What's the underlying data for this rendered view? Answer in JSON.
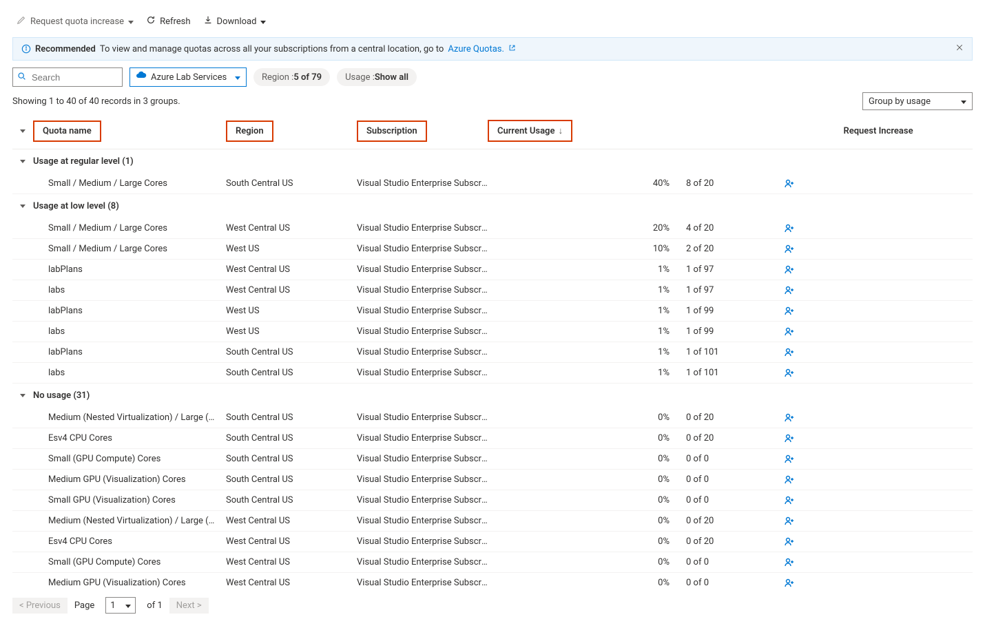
{
  "toolbar": {
    "request_label": "Request quota increase",
    "refresh_label": "Refresh",
    "download_label": "Download"
  },
  "info": {
    "recommended": "Recommended",
    "text": "To view and manage quotas across all your subscriptions from a central location, go to ",
    "link": "Azure Quotas."
  },
  "filters": {
    "search_placeholder": "Search",
    "provider": "Azure Lab Services",
    "region_label": "Region : ",
    "region_value": "5 of 79",
    "usage_label": "Usage : ",
    "usage_value": "Show all"
  },
  "summary": "Showing 1 to 40 of 40 records in 3 groups.",
  "group_select": "Group by usage",
  "headers": {
    "quota": "Quota name",
    "region": "Region",
    "subscription": "Subscription",
    "usage": "Current Usage",
    "request": "Request Increase"
  },
  "groups": [
    {
      "title": "Usage at regular level (1)",
      "rows": [
        {
          "quota": "Small / Medium / Large Cores",
          "region": "South Central US",
          "sub": "Visual Studio Enterprise Subscri…",
          "pct": 40,
          "color": "green",
          "of": "8 of 20"
        }
      ]
    },
    {
      "title": "Usage at low level (8)",
      "rows": [
        {
          "quota": "Small / Medium / Large Cores",
          "region": "West Central US",
          "sub": "Visual Studio Enterprise Subscri…",
          "pct": 20,
          "color": "blue",
          "of": "4 of 20"
        },
        {
          "quota": "Small / Medium / Large Cores",
          "region": "West US",
          "sub": "Visual Studio Enterprise Subscri…",
          "pct": 10,
          "color": "blue",
          "of": "2 of 20"
        },
        {
          "quota": "labPlans",
          "region": "West Central US",
          "sub": "Visual Studio Enterprise Subscri…",
          "pct": 1,
          "color": "blue",
          "of": "1 of 97"
        },
        {
          "quota": "labs",
          "region": "West Central US",
          "sub": "Visual Studio Enterprise Subscri…",
          "pct": 1,
          "color": "blue",
          "of": "1 of 97"
        },
        {
          "quota": "labPlans",
          "region": "West US",
          "sub": "Visual Studio Enterprise Subscri…",
          "pct": 1,
          "color": "blue",
          "of": "1 of 99"
        },
        {
          "quota": "labs",
          "region": "West US",
          "sub": "Visual Studio Enterprise Subscri…",
          "pct": 1,
          "color": "blue",
          "of": "1 of 99"
        },
        {
          "quota": "labPlans",
          "region": "South Central US",
          "sub": "Visual Studio Enterprise Subscri…",
          "pct": 1,
          "color": "blue",
          "of": "1 of 101"
        },
        {
          "quota": "labs",
          "region": "South Central US",
          "sub": "Visual Studio Enterprise Subscri…",
          "pct": 1,
          "color": "blue",
          "of": "1 of 101"
        }
      ]
    },
    {
      "title": "No usage (31)",
      "rows": [
        {
          "quota": "Medium (Nested Virtualization) / Large (Nested …",
          "region": "South Central US",
          "sub": "Visual Studio Enterprise Subscri…",
          "pct": 0,
          "color": "blue",
          "of": "0 of 20"
        },
        {
          "quota": "Esv4 CPU Cores",
          "region": "South Central US",
          "sub": "Visual Studio Enterprise Subscri…",
          "pct": 0,
          "color": "blue",
          "of": "0 of 20"
        },
        {
          "quota": "Small (GPU Compute) Cores",
          "region": "South Central US",
          "sub": "Visual Studio Enterprise Subscri…",
          "pct": 0,
          "color": "blue",
          "of": "0 of 0"
        },
        {
          "quota": "Medium GPU (Visualization) Cores",
          "region": "South Central US",
          "sub": "Visual Studio Enterprise Subscri…",
          "pct": 0,
          "color": "blue",
          "of": "0 of 0"
        },
        {
          "quota": "Small GPU (Visualization) Cores",
          "region": "South Central US",
          "sub": "Visual Studio Enterprise Subscri…",
          "pct": 0,
          "color": "blue",
          "of": "0 of 0"
        },
        {
          "quota": "Medium (Nested Virtualization) / Large (Nested …",
          "region": "West Central US",
          "sub": "Visual Studio Enterprise Subscri…",
          "pct": 0,
          "color": "blue",
          "of": "0 of 20"
        },
        {
          "quota": "Esv4 CPU Cores",
          "region": "West Central US",
          "sub": "Visual Studio Enterprise Subscri…",
          "pct": 0,
          "color": "blue",
          "of": "0 of 20"
        },
        {
          "quota": "Small (GPU Compute) Cores",
          "region": "West Central US",
          "sub": "Visual Studio Enterprise Subscri…",
          "pct": 0,
          "color": "blue",
          "of": "0 of 0"
        },
        {
          "quota": "Medium GPU (Visualization) Cores",
          "region": "West Central US",
          "sub": "Visual Studio Enterprise Subscri…",
          "pct": 0,
          "color": "blue",
          "of": "0 of 0"
        }
      ]
    }
  ],
  "pager": {
    "prev": "< Previous",
    "page_label": "Page",
    "page_value": "1",
    "of_label": "of 1",
    "next": "Next >"
  }
}
